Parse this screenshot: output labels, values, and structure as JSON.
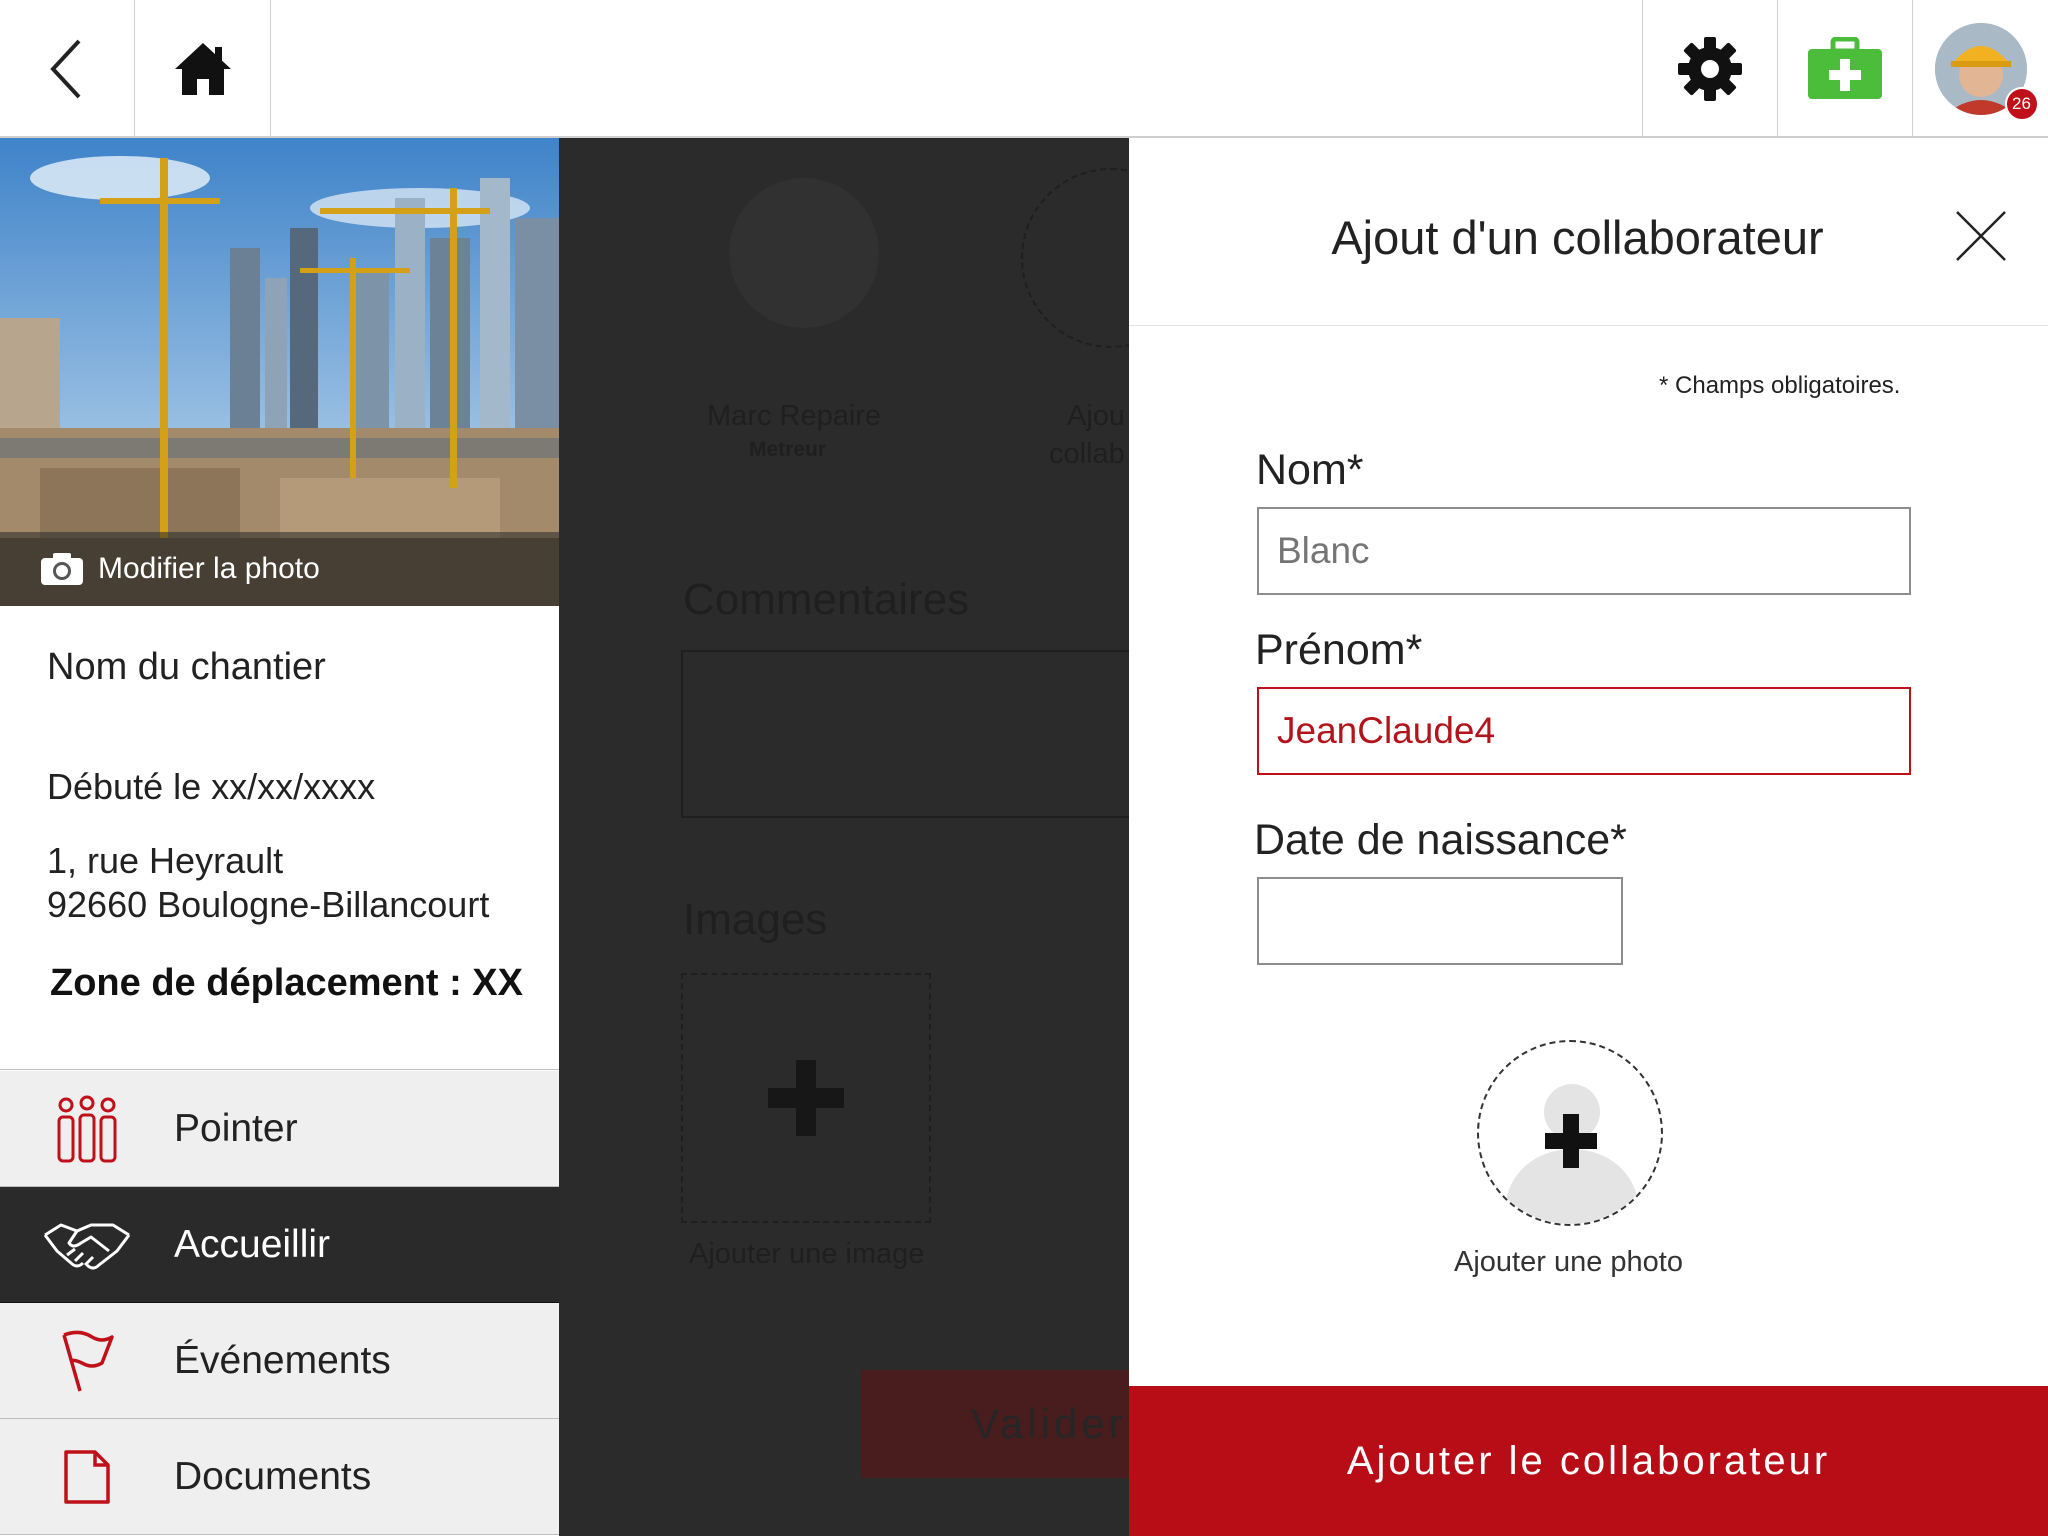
{
  "topbar": {
    "back_icon": "chevron-left-icon",
    "home_icon": "home-icon",
    "settings_icon": "gear-icon",
    "firstaid_icon": "first-aid-kit-icon",
    "notification_count": "26",
    "colors": {
      "firstaid_green": "#4bbd3a",
      "badge_red": "#c0101a"
    }
  },
  "site": {
    "photo_caption": "Modifier la photo",
    "name": "Nom du chantier",
    "started": "Débuté le xx/xx/xxxx",
    "address_line1": "1, rue Heyrault",
    "address_line2": "92660 Boulogne-Billancourt",
    "zone": "Zone de déplacement : XX"
  },
  "menu": {
    "items": [
      {
        "label": "Pointer",
        "icon": "team-icon",
        "active": false
      },
      {
        "label": "Accueillir",
        "icon": "handshake-icon",
        "active": true
      },
      {
        "label": "Événements",
        "icon": "flag-icon",
        "active": false
      },
      {
        "label": "Documents",
        "icon": "document-icon",
        "active": false
      }
    ]
  },
  "background_form": {
    "member_name": "Marc Repaire",
    "member_role": "Metreur",
    "add_label_line1": "Ajou",
    "add_label_line2": "collab",
    "comments_label": "Commentaires",
    "images_label": "Images",
    "add_image_label": "Ajouter une image",
    "validate_label": "Valider"
  },
  "dialog": {
    "title": "Ajout d'un collaborateur",
    "required_note": "* Champs obligatoires.",
    "last_name_label": "Nom*",
    "last_name_placeholder": "Blanc",
    "last_name_value": "",
    "first_name_label": "Prénom*",
    "first_name_value": "JeanClaude4",
    "birthdate_label": "Date de naissance*",
    "birthdate_value": "",
    "add_photo_label": "Ajouter une photo",
    "submit_label": "Ajouter le collaborateur",
    "colors": {
      "accent_red": "#b80d16",
      "error_text": "#b3141b"
    }
  }
}
